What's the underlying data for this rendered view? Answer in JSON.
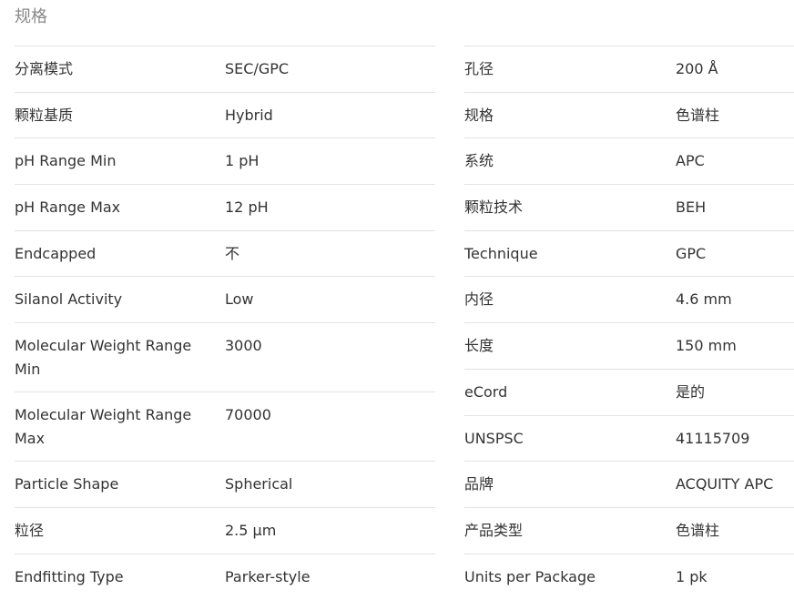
{
  "section_title": "规格",
  "left_specs": [
    {
      "label": "分离模式",
      "value": "SEC/GPC"
    },
    {
      "label": "颗粒基质",
      "value": "Hybrid"
    },
    {
      "label": "pH Range Min",
      "value": "1 pH"
    },
    {
      "label": "pH Range Max",
      "value": "12 pH"
    },
    {
      "label": "Endcapped",
      "value": "不"
    },
    {
      "label": "Silanol Activity",
      "value": "Low"
    },
    {
      "label": "Molecular Weight Range Min",
      "value": "3000"
    },
    {
      "label": "Molecular Weight Range Max",
      "value": "70000"
    },
    {
      "label": "Particle Shape",
      "value": "Spherical"
    },
    {
      "label": "粒径",
      "value": "2.5 µm"
    },
    {
      "label": "Endfitting Type",
      "value": "Parker-style"
    }
  ],
  "right_specs": [
    {
      "label": "孔径",
      "value": "200 Å"
    },
    {
      "label": "规格",
      "value": "色谱柱"
    },
    {
      "label": "系统",
      "value": "APC"
    },
    {
      "label": "颗粒技术",
      "value": "BEH"
    },
    {
      "label": "Technique",
      "value": "GPC"
    },
    {
      "label": "内径",
      "value": "4.6 mm"
    },
    {
      "label": "长度",
      "value": "150 mm"
    },
    {
      "label": "eCord",
      "value": "是的"
    },
    {
      "label": "UNSPSC",
      "value": "41115709"
    },
    {
      "label": "品牌",
      "value": "ACQUITY APC"
    },
    {
      "label": "产品类型",
      "value": "色谱柱"
    },
    {
      "label": "Units per Package",
      "value": "1 pk"
    }
  ]
}
